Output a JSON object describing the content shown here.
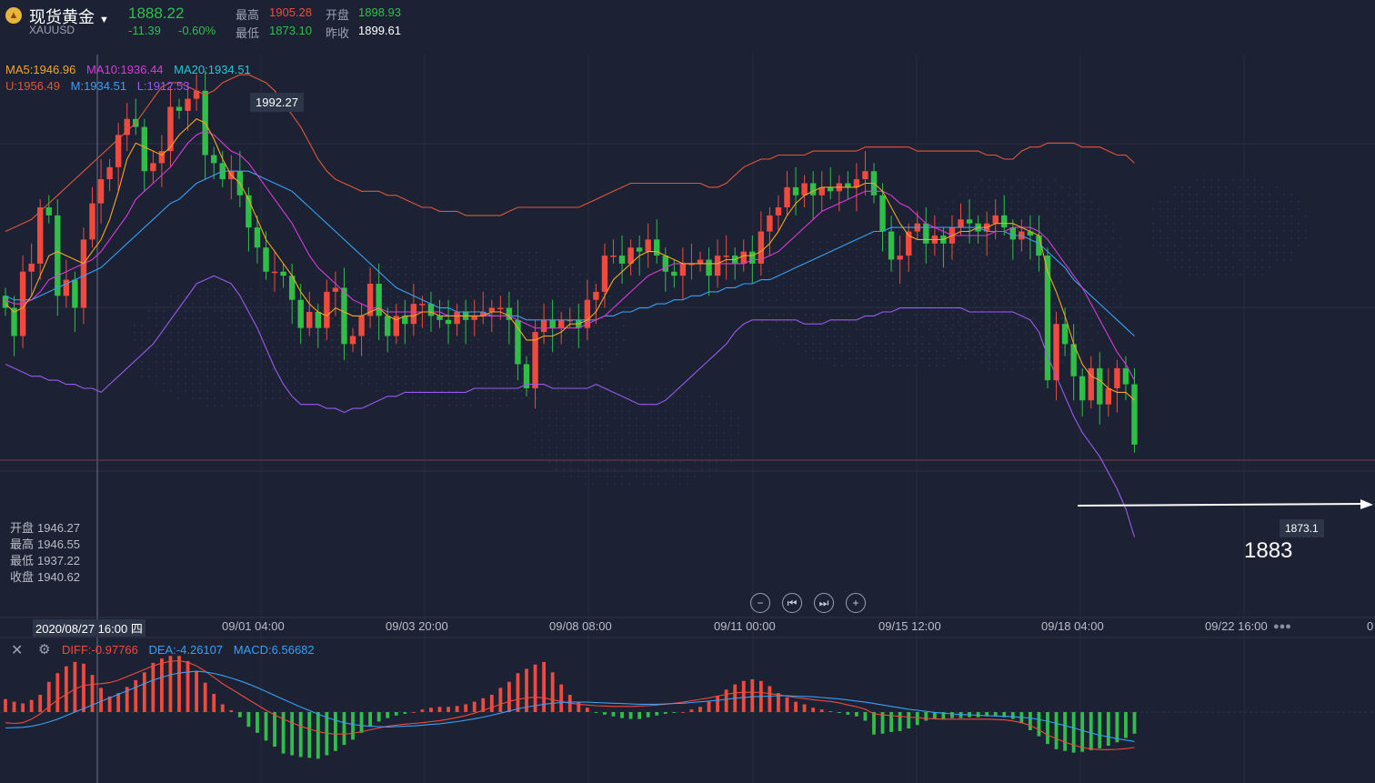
{
  "header": {
    "name": "现货黄金",
    "symbol": "XAUUSD",
    "price": "1888.22",
    "change": "-11.39",
    "change_pct": "-0.60%",
    "high_label": "最高",
    "high": "1905.28",
    "low_label": "最低",
    "low": "1873.10",
    "open_label": "开盘",
    "open": "1898.93",
    "prev_close_label": "昨收",
    "prev_close": "1899.61"
  },
  "legend": {
    "ma5": "MA5:1946.96",
    "ma10": "MA10:1936.44",
    "ma20": "MA20:1934.51",
    "upper": "U:1956.49",
    "mid": "M:1934.51",
    "lower": "L:1912.53"
  },
  "ohlc_panel": {
    "open_label": "开盘",
    "open": "1946.27",
    "high_label": "最高",
    "high": "1946.55",
    "low_label": "最低",
    "low": "1937.22",
    "close_label": "收盘",
    "close": "1940.62"
  },
  "annotations": {
    "peak": "1992.27",
    "trough": "1873.1",
    "handwritten": "1883"
  },
  "x_axis": {
    "cursor_label": "2020/08/27 16:00 四",
    "ticks": [
      "09/01 04:00",
      "09/03 20:00",
      "09/08 08:00",
      "09/11 00:00",
      "09/15 12:00",
      "09/18 04:00",
      "09/22 16:00",
      "0"
    ]
  },
  "macd_legend": {
    "diff": "DIFF:-0.97766",
    "dea": "DEA:-4.26107",
    "macd": "MACD:6.56682"
  },
  "colors": {
    "up": "#f04a3e",
    "down": "#2fbf49",
    "ma5": "#f5a623",
    "ma10": "#d63bd8",
    "ma20": "#3a9ff5",
    "upper": "#e0553a",
    "lower": "#9b59f0",
    "background": "#1c2233"
  },
  "chart_data": {
    "type": "candlestick",
    "title": "现货黄金 XAUUSD",
    "ylim": [
      1860,
      2000
    ],
    "open": [
      1940,
      1937,
      1930,
      1946,
      1948,
      1962,
      1960,
      1940,
      1944,
      1937,
      1954,
      1963,
      1969,
      1972,
      1980,
      1984,
      1982,
      1971,
      1973,
      1976,
      1987,
      1986,
      1989,
      1991,
      1975,
      1973,
      1969,
      1971,
      1965,
      1957,
      1952,
      1946,
      1946,
      1945,
      1939,
      1932,
      1936,
      1932,
      1941,
      1942,
      1928,
      1930,
      1935,
      1943,
      1935,
      1930,
      1935,
      1933,
      1938,
      1938,
      1935,
      1934,
      1933,
      1936,
      1934,
      1935,
      1936,
      1937,
      1937,
      1934,
      1923,
      1917,
      1931,
      1934,
      1932,
      1934,
      1934,
      1932,
      1939,
      1941,
      1950,
      1950,
      1948,
      1952,
      1951,
      1954,
      1950,
      1946,
      1945,
      1948,
      1948,
      1949,
      1945,
      1950,
      1950,
      1948,
      1951,
      1948,
      1956,
      1960,
      1962,
      1967,
      1965,
      1968,
      1965,
      1967,
      1966,
      1968,
      1967,
      1969,
      1971,
      1965,
      1956,
      1949,
      1950,
      1956,
      1958,
      1953,
      1955,
      1953,
      1957,
      1959,
      1958,
      1956,
      1958,
      1960,
      1957,
      1954,
      1956,
      1955,
      1950,
      1919,
      1933,
      1928,
      1920,
      1914,
      1922,
      1913,
      1917,
      1922,
      1918
    ],
    "close": [
      1937,
      1930,
      1946,
      1948,
      1962,
      1960,
      1940,
      1944,
      1937,
      1954,
      1963,
      1969,
      1972,
      1980,
      1984,
      1982,
      1971,
      1973,
      1976,
      1987,
      1986,
      1989,
      1991,
      1975,
      1973,
      1969,
      1971,
      1965,
      1957,
      1952,
      1946,
      1946,
      1945,
      1939,
      1932,
      1936,
      1932,
      1941,
      1942,
      1928,
      1930,
      1935,
      1943,
      1935,
      1930,
      1935,
      1933,
      1938,
      1938,
      1935,
      1934,
      1933,
      1936,
      1934,
      1935,
      1936,
      1937,
      1937,
      1934,
      1923,
      1917,
      1931,
      1934,
      1932,
      1934,
      1934,
      1932,
      1939,
      1941,
      1950,
      1950,
      1948,
      1952,
      1951,
      1954,
      1950,
      1946,
      1945,
      1948,
      1948,
      1949,
      1945,
      1950,
      1950,
      1948,
      1951,
      1948,
      1956,
      1960,
      1962,
      1967,
      1965,
      1968,
      1965,
      1967,
      1966,
      1968,
      1967,
      1969,
      1971,
      1965,
      1956,
      1949,
      1950,
      1956,
      1958,
      1953,
      1955,
      1953,
      1957,
      1959,
      1958,
      1956,
      1958,
      1960,
      1957,
      1954,
      1956,
      1955,
      1950,
      1919,
      1933,
      1928,
      1920,
      1914,
      1922,
      1913,
      1917,
      1922,
      1918,
      1903
    ],
    "ma5": [
      1938,
      1936,
      1937,
      1940,
      1945,
      1950,
      1951,
      1950,
      1949,
      1948,
      1951,
      1954,
      1959,
      1966,
      1974,
      1978,
      1977,
      1976,
      1975,
      1977,
      1980,
      1982,
      1984,
      1983,
      1979,
      1974,
      1970,
      1968,
      1964,
      1959,
      1954,
      1951,
      1948,
      1945,
      1941,
      1938,
      1936,
      1935,
      1937,
      1936,
      1935,
      1935,
      1936,
      1937,
      1935,
      1934,
      1935,
      1935,
      1936,
      1936,
      1935,
      1935,
      1935,
      1935,
      1935,
      1935,
      1936,
      1936,
      1935,
      1932,
      1929,
      1929,
      1930,
      1930,
      1931,
      1933,
      1933,
      1934,
      1936,
      1940,
      1944,
      1946,
      1948,
      1950,
      1951,
      1951,
      1950,
      1949,
      1948,
      1948,
      1948,
      1948,
      1948,
      1949,
      1949,
      1950,
      1950,
      1951,
      1953,
      1956,
      1960,
      1963,
      1965,
      1966,
      1967,
      1967,
      1967,
      1967,
      1967,
      1968,
      1968,
      1966,
      1962,
      1958,
      1955,
      1954,
      1954,
      1954,
      1954,
      1955,
      1956,
      1956,
      1957,
      1957,
      1958,
      1958,
      1958,
      1957,
      1956,
      1955,
      1946,
      1941,
      1935,
      1928,
      1923,
      1920,
      1919,
      1917,
      1916,
      1916,
      1914
    ],
    "ma10": [
      1939,
      1938,
      1938,
      1939,
      1941,
      1944,
      1945,
      1946,
      1947,
      1948,
      1949,
      1951,
      1954,
      1957,
      1960,
      1964,
      1966,
      1968,
      1970,
      1972,
      1975,
      1978,
      1980,
      1981,
      1980,
      1978,
      1976,
      1975,
      1973,
      1970,
      1967,
      1964,
      1961,
      1958,
      1954,
      1950,
      1947,
      1945,
      1943,
      1941,
      1939,
      1938,
      1937,
      1937,
      1936,
      1936,
      1936,
      1936,
      1936,
      1936,
      1936,
      1935,
      1935,
      1935,
      1935,
      1935,
      1935,
      1935,
      1935,
      1934,
      1933,
      1932,
      1932,
      1932,
      1932,
      1932,
      1932,
      1933,
      1934,
      1935,
      1937,
      1939,
      1941,
      1943,
      1945,
      1946,
      1947,
      1948,
      1948,
      1948,
      1948,
      1948,
      1948,
      1948,
      1948,
      1948,
      1949,
      1949,
      1950,
      1951,
      1953,
      1955,
      1957,
      1959,
      1961,
      1962,
      1963,
      1964,
      1965,
      1966,
      1966,
      1966,
      1965,
      1963,
      1962,
      1960,
      1958,
      1957,
      1956,
      1955,
      1955,
      1955,
      1955,
      1955,
      1956,
      1956,
      1957,
      1957,
      1957,
      1956,
      1954,
      1951,
      1948,
      1945,
      1942,
      1938,
      1934,
      1930,
      1926,
      1923,
      1919
    ],
    "ma20": [
      1940,
      1939,
      1939,
      1939,
      1940,
      1941,
      1942,
      1943,
      1944,
      1945,
      1946,
      1947,
      1949,
      1951,
      1953,
      1955,
      1957,
      1959,
      1961,
      1963,
      1964,
      1966,
      1968,
      1969,
      1970,
      1971,
      1971,
      1971,
      1971,
      1970,
      1969,
      1968,
      1967,
      1966,
      1964,
      1962,
      1960,
      1958,
      1956,
      1954,
      1952,
      1950,
      1948,
      1946,
      1944,
      1942,
      1941,
      1940,
      1939,
      1938,
      1937,
      1937,
      1936,
      1936,
      1936,
      1936,
      1935,
      1935,
      1935,
      1935,
      1934,
      1934,
      1934,
      1934,
      1934,
      1934,
      1934,
      1934,
      1934,
      1935,
      1935,
      1936,
      1936,
      1937,
      1937,
      1938,
      1938,
      1939,
      1939,
      1940,
      1940,
      1941,
      1941,
      1942,
      1942,
      1943,
      1943,
      1944,
      1944,
      1945,
      1946,
      1947,
      1948,
      1949,
      1950,
      1951,
      1952,
      1953,
      1954,
      1955,
      1956,
      1956,
      1957,
      1957,
      1957,
      1957,
      1957,
      1957,
      1957,
      1957,
      1957,
      1957,
      1957,
      1956,
      1956,
      1956,
      1955,
      1955,
      1954,
      1953,
      1951,
      1949,
      1947,
      1944,
      1942,
      1940,
      1938,
      1936,
      1934,
      1932,
      1930
    ],
    "boll_upper": [
      1956,
      1957,
      1958,
      1959,
      1961,
      1963,
      1965,
      1967,
      1969,
      1971,
      1973,
      1975,
      1977,
      1979,
      1981,
      1983,
      1986,
      1989,
      1992,
      1993,
      1993,
      1992,
      1991,
      1990,
      1991,
      1993,
      1994,
      1995,
      1995,
      1994,
      1993,
      1991,
      1988,
      1985,
      1982,
      1978,
      1974,
      1971,
      1969,
      1968,
      1967,
      1966,
      1966,
      1966,
      1965,
      1965,
      1964,
      1963,
      1962,
      1962,
      1961,
      1961,
      1961,
      1960,
      1960,
      1960,
      1960,
      1960,
      1961,
      1962,
      1962,
      1962,
      1962,
      1962,
      1962,
      1962,
      1962,
      1963,
      1964,
      1965,
      1966,
      1967,
      1968,
      1968,
      1968,
      1968,
      1968,
      1968,
      1968,
      1968,
      1968,
      1967,
      1967,
      1968,
      1970,
      1972,
      1973,
      1974,
      1974,
      1975,
      1975,
      1975,
      1975,
      1976,
      1976,
      1976,
      1976,
      1976,
      1976,
      1977,
      1977,
      1977,
      1977,
      1977,
      1977,
      1976,
      1976,
      1976,
      1976,
      1976,
      1976,
      1976,
      1976,
      1975,
      1975,
      1974,
      1974,
      1976,
      1977,
      1977,
      1978,
      1978,
      1978,
      1978,
      1977,
      1977,
      1977,
      1976,
      1975,
      1975,
      1973
    ],
    "boll_lower": [
      1923,
      1922,
      1921,
      1920,
      1920,
      1919,
      1919,
      1918,
      1918,
      1917,
      1917,
      1916,
      1918,
      1920,
      1922,
      1924,
      1926,
      1928,
      1931,
      1934,
      1937,
      1940,
      1943,
      1944,
      1945,
      1944,
      1943,
      1940,
      1936,
      1932,
      1927,
      1922,
      1918,
      1915,
      1913,
      1913,
      1913,
      1912,
      1912,
      1911,
      1912,
      1912,
      1913,
      1914,
      1915,
      1915,
      1916,
      1916,
      1916,
      1916,
      1916,
      1916,
      1916,
      1916,
      1917,
      1917,
      1917,
      1917,
      1917,
      1917,
      1918,
      1918,
      1918,
      1917,
      1917,
      1917,
      1917,
      1917,
      1918,
      1917,
      1916,
      1915,
      1914,
      1913,
      1913,
      1913,
      1914,
      1916,
      1918,
      1920,
      1922,
      1924,
      1926,
      1928,
      1931,
      1933,
      1934,
      1934,
      1934,
      1934,
      1934,
      1934,
      1933,
      1933,
      1933,
      1934,
      1934,
      1934,
      1934,
      1935,
      1935,
      1936,
      1936,
      1937,
      1937,
      1937,
      1937,
      1937,
      1937,
      1937,
      1937,
      1936,
      1936,
      1936,
      1936,
      1936,
      1936,
      1935,
      1934,
      1931,
      1925,
      1920,
      1915,
      1910,
      1906,
      1903,
      1900,
      1896,
      1892,
      1887,
      1880
    ],
    "macd_hist": [
      1.5,
      1.2,
      1.0,
      1.4,
      2.0,
      3.5,
      4.5,
      5.3,
      5.8,
      5.6,
      4.3,
      2.8,
      1.8,
      2.2,
      2.9,
      3.7,
      4.6,
      5.7,
      6.2,
      6.5,
      6.5,
      5.9,
      4.7,
      3.4,
      2.1,
      0.9,
      0.2,
      -0.6,
      -1.7,
      -2.4,
      -3.3,
      -4.0,
      -4.8,
      -5.0,
      -5.2,
      -5.3,
      -5.4,
      -5.0,
      -4.5,
      -3.8,
      -3.2,
      -2.4,
      -1.7,
      -1.1,
      -0.7,
      -0.4,
      -0.2,
      0.0,
      0.3,
      0.5,
      0.6,
      0.6,
      0.7,
      0.9,
      1.2,
      1.6,
      2.0,
      2.8,
      3.5,
      4.5,
      5.0,
      5.5,
      5.8,
      4.6,
      3.2,
      2.0,
      1.2,
      0.5,
      -0.1,
      -0.3,
      -0.5,
      -0.7,
      -0.8,
      -0.8,
      -0.6,
      -0.4,
      -0.2,
      -0.1,
      0.0,
      0.3,
      0.6,
      1.2,
      1.9,
      2.6,
      3.2,
      3.6,
      3.8,
      3.6,
      3.0,
      2.2,
      1.7,
      1.2,
      0.9,
      0.5,
      0.3,
      0.1,
      -0.1,
      -0.3,
      -0.5,
      -1.0,
      -2.6,
      -2.5,
      -2.3,
      -2.2,
      -1.9,
      -1.5,
      -1.0,
      -0.8,
      -0.8,
      -0.7,
      -0.7,
      -0.6,
      -0.6,
      -0.5,
      -0.5,
      -0.6,
      -0.8,
      -1.3,
      -2.1,
      -2.8,
      -3.7,
      -4.3,
      -4.5,
      -4.7,
      -4.6,
      -4.4,
      -4.2,
      -3.9,
      -3.5,
      -3.0,
      -2.5
    ],
    "macd_diff": [
      -3.0,
      -3.2,
      -3.0,
      -2.0,
      -0.5,
      1.5,
      3.5,
      5.0,
      6.5,
      7.5,
      7.8,
      8.0,
      8.3,
      9.0,
      10.0,
      11.0,
      12.0,
      13.0,
      13.8,
      14.3,
      14.5,
      14.0,
      13.0,
      11.5,
      9.8,
      8.0,
      6.5,
      5.0,
      3.5,
      2.0,
      0.5,
      -0.8,
      -2.0,
      -3.0,
      -4.0,
      -4.8,
      -5.5,
      -6.0,
      -6.2,
      -6.2,
      -6.0,
      -5.5,
      -5.0,
      -4.5,
      -4.0,
      -3.7,
      -3.4,
      -3.2,
      -3.0,
      -2.7,
      -2.4,
      -2.0,
      -1.5,
      -1.0,
      -0.3,
      0.5,
      1.3,
      2.2,
      3.0,
      3.6,
      4.0,
      4.2,
      4.0,
      3.5,
      3.0,
      2.5,
      2.2,
      2.0,
      1.8,
      1.7,
      1.6,
      1.6,
      1.6,
      1.7,
      1.8,
      2.0,
      2.2,
      2.5,
      2.8,
      3.2,
      3.6,
      4.0,
      4.5,
      5.0,
      5.4,
      5.6,
      5.6,
      5.5,
      5.2,
      4.9,
      4.5,
      4.1,
      3.8,
      3.5,
      3.2,
      3.0,
      2.6,
      2.0,
      1.5,
      0.8,
      -0.5,
      -0.8,
      -1.0,
      -1.2,
      -1.4,
      -1.6,
      -1.8,
      -1.9,
      -2.0,
      -2.0,
      -2.0,
      -2.0,
      -2.0,
      -2.0,
      -2.1,
      -2.2,
      -2.5,
      -3.0,
      -3.8,
      -5.0,
      -6.5,
      -7.5,
      -8.5,
      -9.3,
      -10.0,
      -10.4,
      -10.6,
      -10.6,
      -10.5,
      -10.3,
      -10.0
    ],
    "macd_dea": [
      -4.5,
      -4.4,
      -4.3,
      -4.0,
      -3.5,
      -2.8,
      -2.0,
      -1.0,
      0.0,
      1.0,
      2.0,
      3.0,
      4.0,
      5.0,
      6.0,
      7.0,
      8.0,
      9.0,
      9.8,
      10.5,
      11.0,
      11.3,
      11.5,
      11.3,
      10.9,
      10.3,
      9.6,
      8.8,
      7.9,
      6.9,
      5.8,
      4.7,
      3.6,
      2.5,
      1.4,
      0.4,
      -0.6,
      -1.5,
      -2.3,
      -3.0,
      -3.5,
      -3.8,
      -4.0,
      -4.1,
      -4.2,
      -4.1,
      -4.0,
      -3.9,
      -3.7,
      -3.5,
      -3.3,
      -3.0,
      -2.7,
      -2.3,
      -1.9,
      -1.4,
      -0.9,
      -0.3,
      0.3,
      0.9,
      1.4,
      1.8,
      2.2,
      2.5,
      2.7,
      2.8,
      2.8,
      2.8,
      2.7,
      2.6,
      2.5,
      2.4,
      2.3,
      2.2,
      2.2,
      2.2,
      2.3,
      2.4,
      2.5,
      2.7,
      2.9,
      3.1,
      3.3,
      3.6,
      3.9,
      4.1,
      4.3,
      4.4,
      4.5,
      4.6,
      4.6,
      4.5,
      4.4,
      4.3,
      4.1,
      3.9,
      3.7,
      3.4,
      3.1,
      2.8,
      2.4,
      2.0,
      1.6,
      1.2,
      0.8,
      0.5,
      0.2,
      -0.1,
      -0.3,
      -0.5,
      -0.7,
      -0.8,
      -0.9,
      -1.0,
      -1.1,
      -1.2,
      -1.3,
      -1.5,
      -1.7,
      -2.1,
      -2.6,
      -3.2,
      -3.8,
      -4.5,
      -5.2,
      -5.9,
      -6.5,
      -7.0,
      -7.5,
      -7.9,
      -8.3
    ]
  }
}
